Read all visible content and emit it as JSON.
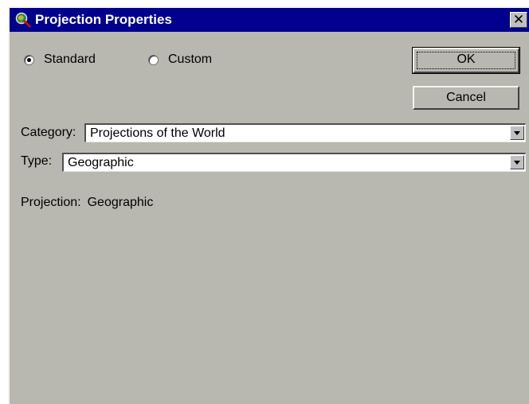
{
  "window": {
    "title": "Projection Properties",
    "close_glyph": "✕",
    "icon": "globe-magnifier-icon"
  },
  "projection_mode": {
    "options": [
      {
        "label": "Standard",
        "selected": true
      },
      {
        "label": "Custom",
        "selected": false
      }
    ]
  },
  "buttons": {
    "ok_label": "OK",
    "cancel_label": "Cancel"
  },
  "category": {
    "label": "Category:",
    "value": "Projections of the World"
  },
  "type": {
    "label": "Type:",
    "value": "Geographic"
  },
  "projection": {
    "label": "Projection:",
    "value": "Geographic"
  },
  "colors": {
    "titlebar": "#00008c",
    "dialog_bg": "#b8b8b0"
  }
}
